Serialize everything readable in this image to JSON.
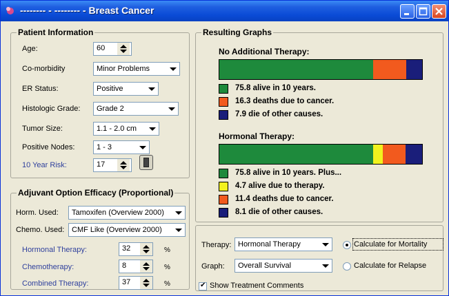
{
  "window": {
    "title": "-------- - -------- - Breast Cancer"
  },
  "patient": {
    "title": "Patient Information",
    "age": {
      "label": "Age:",
      "value": "60"
    },
    "comorbidity": {
      "label": "Co-morbidity",
      "value": "Minor Problems"
    },
    "er_status": {
      "label": "ER Status:",
      "value": "Positive"
    },
    "grade": {
      "label": "Histologic Grade:",
      "value": "Grade 2"
    },
    "tumor_size": {
      "label": "Tumor Size:",
      "value": "1.1 - 2.0 cm"
    },
    "nodes": {
      "label": "Positive Nodes:",
      "value": "1 - 3"
    },
    "risk": {
      "label": "10 Year Risk:",
      "value": "17"
    }
  },
  "adjuvant": {
    "title": "Adjuvant Option Efficacy (Proportional)",
    "horm": {
      "label": "Horm. Used:",
      "value": "Tamoxifen (Overview 2000)"
    },
    "chemo": {
      "label": "Chemo. Used:",
      "value": "CMF Like (Overview 2000)"
    },
    "hormonal": {
      "label": "Hormonal Therapy:",
      "value": "32",
      "unit": "%"
    },
    "chemotherapy": {
      "label": "Chemotherapy:",
      "value": "8",
      "unit": "%"
    },
    "combined": {
      "label": "Combined Therapy:",
      "value": "37",
      "unit": "%"
    }
  },
  "graphs": {
    "title": "Resulting Graphs",
    "no_therapy": {
      "title": "No Additional Therapy:",
      "segments": [
        {
          "value": 75.8,
          "color": "#1e8a3c"
        },
        {
          "value": 16.3,
          "color": "#f25a1e"
        },
        {
          "value": 7.9,
          "color": "#1a1e7a"
        }
      ],
      "legend": [
        {
          "text": "75.8 alive in 10 years.",
          "color": "#1e8a3c"
        },
        {
          "text": "16.3 deaths due to cancer.",
          "color": "#f25a1e"
        },
        {
          "text": "7.9 die of other causes.",
          "color": "#1a1e7a"
        }
      ]
    },
    "hormonal": {
      "title": "Hormonal Therapy:",
      "segments": [
        {
          "value": 75.8,
          "color": "#1e8a3c"
        },
        {
          "value": 4.7,
          "color": "#f2f21e"
        },
        {
          "value": 11.4,
          "color": "#f25a1e"
        },
        {
          "value": 8.1,
          "color": "#1a1e7a"
        }
      ],
      "legend": [
        {
          "text": "75.8 alive in 10 years. Plus...",
          "color": "#1e8a3c"
        },
        {
          "text": "4.7 alive due to therapy.",
          "color": "#f2f21e"
        },
        {
          "text": "11.4 deaths due to cancer.",
          "color": "#f25a1e"
        },
        {
          "text": "8.1 die of other causes.",
          "color": "#1a1e7a"
        }
      ]
    }
  },
  "controls": {
    "therapy": {
      "label": "Therapy:",
      "value": "Hormonal Therapy"
    },
    "graph": {
      "label": "Graph:",
      "value": "Overall Survival"
    },
    "mortality": "Calculate for Mortality",
    "relapse": "Calculate for Relapse",
    "comments": "Show Treatment Comments"
  }
}
